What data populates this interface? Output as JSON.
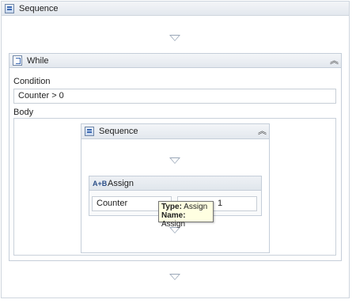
{
  "outer_sequence": {
    "title": "Sequence"
  },
  "while": {
    "title": "While",
    "collapse_glyph": "︽",
    "condition_label": "Condition",
    "condition_value": "Counter > 0",
    "body_label": "Body"
  },
  "inner_sequence": {
    "title": "Sequence",
    "collapse_glyph": "︽"
  },
  "assign": {
    "icon_text": "A+B",
    "title": "Assign",
    "to_value": "Counter",
    "value_text": "1"
  },
  "tooltip": {
    "type_label": "Type:",
    "type_value": "Assign",
    "name_label": "Name:",
    "name_value": "Assign"
  },
  "colors": {
    "header_bg": "#e6ebf0",
    "border": "#c5ced9",
    "arrow": "#9aa7b8",
    "tooltip_bg": "#ffffe1"
  }
}
